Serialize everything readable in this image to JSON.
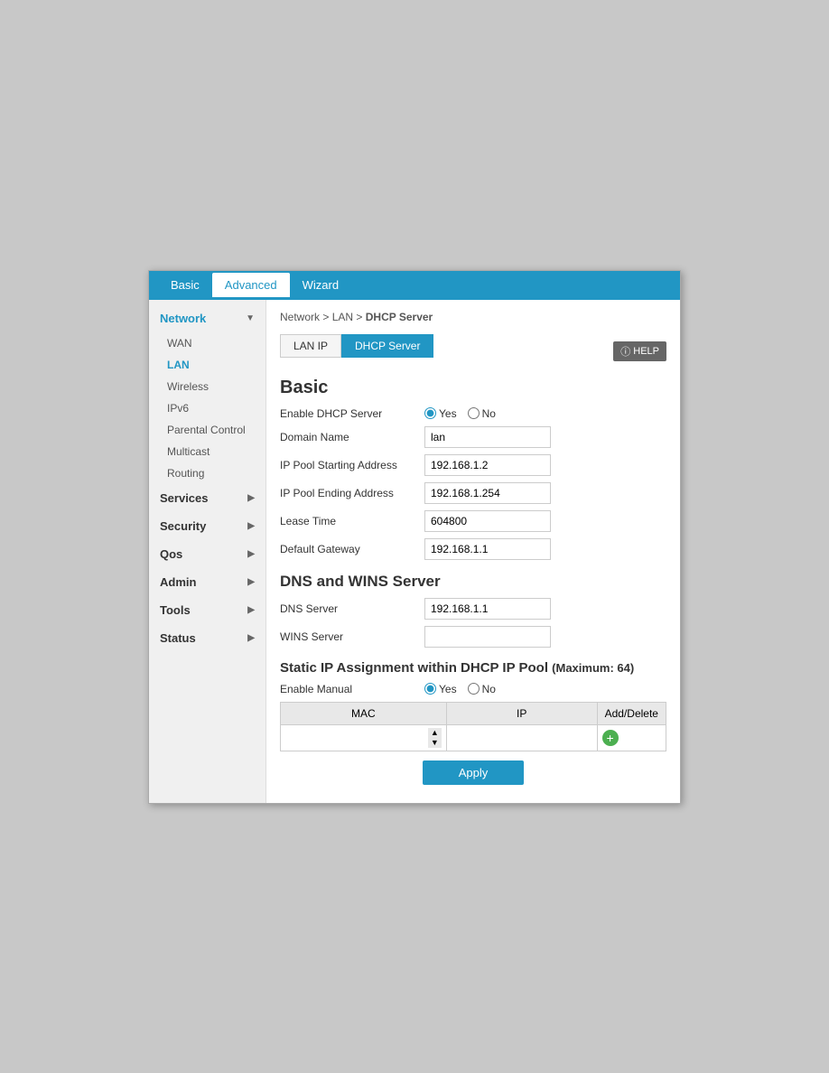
{
  "topNav": {
    "items": [
      {
        "label": "Basic",
        "active": false
      },
      {
        "label": "Advanced",
        "active": true
      },
      {
        "label": "Wizard",
        "active": false
      }
    ]
  },
  "breadcrumb": {
    "parts": [
      "Network",
      "LAN",
      "DHCP Server"
    ],
    "separator": " > "
  },
  "tabs": [
    {
      "label": "LAN IP",
      "active": false
    },
    {
      "label": "DHCP Server",
      "active": true
    }
  ],
  "help": {
    "label": "HELP"
  },
  "sidebar": {
    "sections": [
      {
        "label": "Network",
        "active": true,
        "expanded": true,
        "subItems": [
          "WAN",
          "LAN",
          "Wireless",
          "IPv6",
          "Parental Control",
          "Multicast",
          "Routing"
        ]
      },
      {
        "label": "Services",
        "active": false,
        "expanded": false,
        "subItems": []
      },
      {
        "label": "Security",
        "active": false,
        "expanded": false,
        "subItems": []
      },
      {
        "label": "Qos",
        "active": false,
        "expanded": false,
        "subItems": []
      },
      {
        "label": "Admin",
        "active": false,
        "expanded": false,
        "subItems": []
      },
      {
        "label": "Tools",
        "active": false,
        "expanded": false,
        "subItems": []
      },
      {
        "label": "Status",
        "active": false,
        "expanded": false,
        "subItems": []
      }
    ],
    "activeSub": "LAN"
  },
  "basic": {
    "title": "Basic",
    "fields": {
      "enableDHCP": {
        "label": "Enable DHCP Server",
        "yesLabel": "Yes",
        "noLabel": "No",
        "value": "yes"
      },
      "domainName": {
        "label": "Domain Name",
        "value": "lan"
      },
      "ipPoolStart": {
        "label": "IP Pool Starting Address",
        "value": "192.168.1.2"
      },
      "ipPoolEnd": {
        "label": "IP Pool Ending Address",
        "value": "192.168.1.254"
      },
      "leaseTime": {
        "label": "Lease Time",
        "value": "604800"
      },
      "defaultGateway": {
        "label": "Default Gateway",
        "value": "192.168.1.1"
      }
    }
  },
  "dnsWins": {
    "title": "DNS and WINS Server",
    "fields": {
      "dnsServer": {
        "label": "DNS Server",
        "value": "192.168.1.1"
      },
      "winsServer": {
        "label": "WINS Server",
        "value": ""
      }
    }
  },
  "staticIP": {
    "title": "Static IP Assignment within DHCP IP Pool",
    "subtitle": "(Maximum: 64)",
    "enableManual": {
      "label": "Enable Manual",
      "yesLabel": "Yes",
      "noLabel": "No",
      "value": "yes"
    },
    "table": {
      "columns": [
        "MAC",
        "IP",
        "Add/Delete"
      ],
      "rows": [
        {
          "mac": "",
          "ip": ""
        }
      ]
    }
  },
  "buttons": {
    "apply": "Apply"
  }
}
